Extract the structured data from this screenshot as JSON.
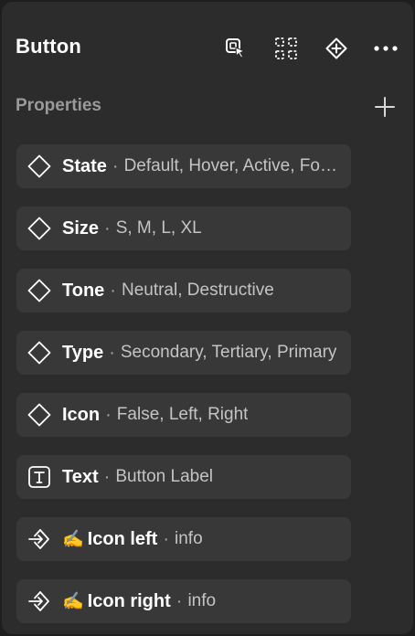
{
  "panel": {
    "title": "Button",
    "header_icons": [
      "select-matching-icon",
      "component-grid-icon",
      "component-diamond-icon",
      "more-icon"
    ]
  },
  "properties": {
    "label": "Properties",
    "add_icon": "plus-icon",
    "items": [
      {
        "icon": "variant-diamond-icon",
        "name": "State",
        "separator": "·",
        "values": "Default, Hover, Active, Focus"
      },
      {
        "icon": "variant-diamond-icon",
        "name": "Size",
        "separator": "·",
        "values": "S, M, L, XL"
      },
      {
        "icon": "variant-diamond-icon",
        "name": "Tone",
        "separator": "·",
        "values": "Neutral, Destructive"
      },
      {
        "icon": "variant-diamond-icon",
        "name": "Type",
        "separator": "·",
        "values": "Secondary, Tertiary, Primary"
      },
      {
        "icon": "variant-diamond-icon",
        "name": "Icon",
        "separator": "·",
        "values": "False, Left, Right"
      },
      {
        "icon": "text-property-icon",
        "name": "Text",
        "separator": "·",
        "values": "Button Label"
      },
      {
        "icon": "instance-swap-icon",
        "emoji": "✍️",
        "name": "Icon left",
        "separator": "·",
        "values": "info"
      },
      {
        "icon": "instance-swap-icon",
        "emoji": "✍️",
        "name": "Icon right",
        "separator": "·",
        "values": "info"
      }
    ]
  },
  "colors": {
    "panel_bg": "#2c2c2c",
    "row_bg": "#383838",
    "text_primary": "#ffffff",
    "text_secondary": "#c4c4c4",
    "label_muted": "#9a9a9a"
  }
}
